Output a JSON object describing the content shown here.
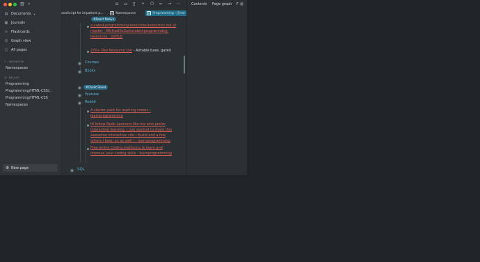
{
  "window_controls": {
    "close_color": "#ff5f57",
    "min_color": "#febc2e",
    "max_color": "#28c840"
  },
  "sidebar": {
    "nav": [
      {
        "label": "Documents",
        "icon": "documents-icon",
        "glyph": "▤",
        "chevron": "▾"
      },
      {
        "label": "Journals",
        "icon": "calendar-icon",
        "glyph": "▦"
      },
      {
        "label": "Flashcards",
        "icon": "flashcards-icon",
        "glyph": "∞"
      },
      {
        "label": "Graph view",
        "icon": "graph-icon",
        "glyph": "⌬"
      },
      {
        "label": "All pages",
        "icon": "pages-icon",
        "glyph": "▢"
      }
    ],
    "favorites_title": "FAVORITES",
    "favorites": [
      {
        "label": "Namespaces"
      }
    ],
    "recent_title": "RECENT",
    "recent": [
      {
        "label": "Programming"
      },
      {
        "label": "Programming/HTML-CSS/..."
      },
      {
        "label": "Programming/HTML-CSS"
      },
      {
        "label": "Namespaces"
      }
    ],
    "new_page": "New page"
  },
  "tabs": [
    {
      "label": "avaScript for impatient p..."
    },
    {
      "label": "Namespaces",
      "icon_letter": "B"
    },
    {
      "label": "Programming - [[lear",
      "icon_letter": "B"
    }
  ],
  "right_panel": {
    "tabs": [
      "Contents",
      "Page graph",
      "F"
    ]
  },
  "content": {
    "tag_react": "#React Native",
    "items_top": [
      {
        "text": "curated-programming-resources/resources.md at master · Michael0x2a/curated-programming-resources · GitHub"
      },
      {
        "text_link": "270+ Dev Resource List",
        "text_rest": " - Airtable base, gated"
      }
    ],
    "courses": "Courses",
    "books": "Books",
    "tag_cheat": "#Cheat Sheet",
    "youtube": "Youtube",
    "reddit": "Reddit",
    "reddit_items": [
      {
        "lines": [
          "A starter pack for aspiring coders :",
          "learnprogramming"
        ]
      },
      {
        "lines": [
          "Hi fellow Noob Learners like me who prefer",
          "interactive learning. I just wanted to share this",
          "awesome interactive site i found and a few",
          "others I been on as well ! : learnprogramming"
        ]
      },
      {
        "lines": [
          "Free online Coding platforms to learn and",
          "improve your coding skills : learnprogramming"
        ]
      }
    ],
    "sql": "SQL"
  }
}
